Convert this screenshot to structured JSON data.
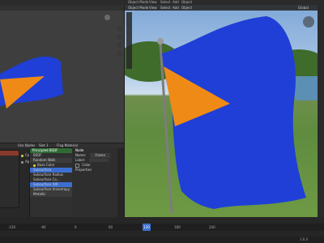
{
  "app": {
    "accent": "#3c6fd1"
  },
  "topbar": {
    "items": [
      "Object Mode",
      "View",
      "Select",
      "Add",
      "Object"
    ]
  },
  "viewport_right": {
    "header_items": [
      "Object Mode",
      "View",
      "Select",
      "Add",
      "Object"
    ],
    "shading_dropdown": "Global"
  },
  "node_editor": {
    "header_items": [
      "Use Nodes",
      "Slot 1",
      "Flag Material"
    ],
    "node_principled": {
      "title": "Principled BSDF",
      "rows": [
        "BSDF",
        "Random Walk",
        "Base Color",
        "Subsurface",
        "Subsurface Radius",
        "Subsurface Co...",
        "Subsurface IOR",
        "Subsurface Anisotropy",
        "Metallic"
      ]
    },
    "node_image": {
      "rows": [
        "Color",
        "Alpha"
      ]
    },
    "node_sidebar": {
      "title": "Node",
      "name_label": "Name:",
      "name_value": "Frame",
      "label_label": "Label:",
      "color_label": "Color",
      "properties_label": "Properties"
    }
  },
  "timeline": {
    "ticks": [
      "-120",
      "-60",
      "0",
      "60",
      "120",
      "180",
      "240"
    ],
    "current_frame": "120"
  },
  "status": {
    "version": "3.6.0"
  },
  "colors": {
    "flag_blue": "#1f3fd6",
    "flag_orange": "#f08a16",
    "panel": "#303030"
  }
}
